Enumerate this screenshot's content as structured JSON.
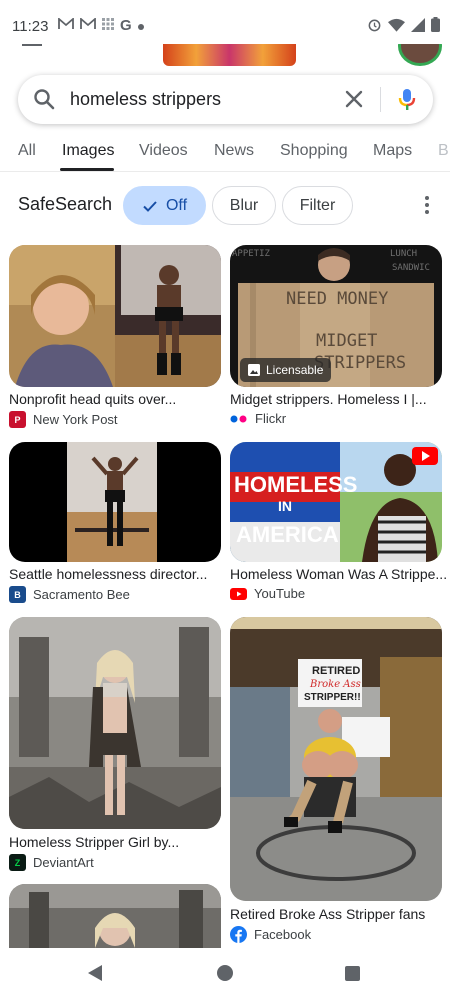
{
  "status_bar": {
    "time": "11:23",
    "left_icons": [
      "gmail-icon",
      "gmail-icon",
      "grid-icon",
      "google-icon",
      "dot-icon"
    ],
    "right_icons": [
      "alarm-icon",
      "wifi-icon",
      "signal-icon",
      "battery-icon"
    ]
  },
  "search": {
    "query": "homeless strippers"
  },
  "tabs": [
    "All",
    "Images",
    "Videos",
    "News",
    "Shopping",
    "Maps",
    "B"
  ],
  "active_tab": "Images",
  "safesearch": {
    "label": "SafeSearch",
    "chips": [
      "Off",
      "Blur",
      "Filter"
    ],
    "selected": "Off"
  },
  "results": [
    {
      "title": "Nonprofit head quits over...",
      "source": "New York Post",
      "favicon_color": "#c8102e"
    },
    {
      "title": "Midget strippers. Homeless I |...",
      "source": "Flickr",
      "favicon_color": "#0063dc",
      "badge": "Licensable"
    },
    {
      "title": "Seattle homelessness director...",
      "source": "Sacramento Bee",
      "favicon_color": "#1a4c8c"
    },
    {
      "title": "Homeless Woman Was A Strippe...",
      "source": "YouTube",
      "favicon_color": "#ff0000"
    },
    {
      "title": "Homeless Stripper Girl by...",
      "source": "DeviantArt",
      "favicon_color": "#05cc47"
    },
    {
      "title": "Retired Broke Ass Stripper fans",
      "source": "Facebook",
      "favicon_color": "#1877f2"
    }
  ],
  "image_texts": {
    "flickr_sign": [
      "NEED MONEY",
      "MIDGET",
      "STRIPPERS"
    ],
    "flickr_bg": [
      "LUNCH",
      "APPETIZ",
      "SANDWIC"
    ],
    "youtube_overlay": [
      "HOMELESS",
      "IN",
      "AMERICA"
    ],
    "facebook_sign": [
      "RETIRED",
      "Broke Ass",
      "STRIPPER!!"
    ]
  }
}
